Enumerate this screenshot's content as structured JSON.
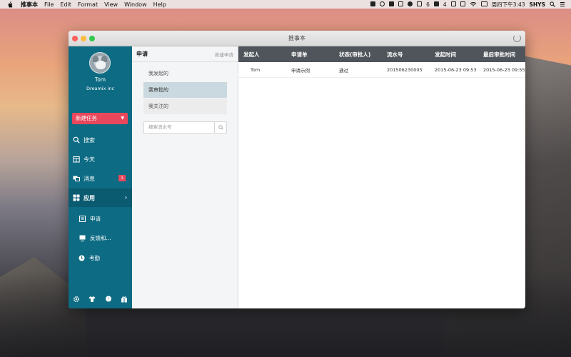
{
  "menubar": {
    "app_name": "推事本",
    "menus": [
      "File",
      "Edit",
      "Format",
      "View",
      "Window",
      "Help"
    ],
    "status_count_1": "6",
    "status_count_2": "4",
    "clock": "周四下午3:43",
    "user": "SHYS"
  },
  "window": {
    "title": "推事本"
  },
  "sidebar": {
    "username": "Tom",
    "company": "Dreamix inc",
    "new_task_label": "新建任务",
    "nav": [
      {
        "label": "搜索",
        "icon": "search-icon"
      },
      {
        "label": "今天",
        "icon": "calendar-icon"
      },
      {
        "label": "消息",
        "icon": "message-icon",
        "badge": "1"
      },
      {
        "label": "应用",
        "icon": "apps-icon"
      }
    ],
    "sub": [
      {
        "label": "申请",
        "icon": "document-icon"
      },
      {
        "label": "反馈和...",
        "icon": "feedback-icon"
      },
      {
        "label": "考勤",
        "icon": "clock-icon"
      }
    ]
  },
  "panel": {
    "title": "申请",
    "new_label": "新建申请",
    "filters": [
      "我发起的",
      "我审批的",
      "我关注的"
    ],
    "search_placeholder": "搜索流水号"
  },
  "table": {
    "headers": [
      "发起人",
      "申请单",
      "状态(审批人)",
      "流水号",
      "发起时间",
      "最后审批时间"
    ],
    "rows": [
      [
        "Tom",
        "申请示例",
        "通过",
        "201506230005",
        "2015-06-23 09:53",
        "2015-06-23 09:55"
      ]
    ]
  },
  "colors": {
    "sidebar": "#0d6b83",
    "accent_red": "#e9475c",
    "table_header": "#4f555b",
    "selected_filter": "#c9d9df"
  }
}
